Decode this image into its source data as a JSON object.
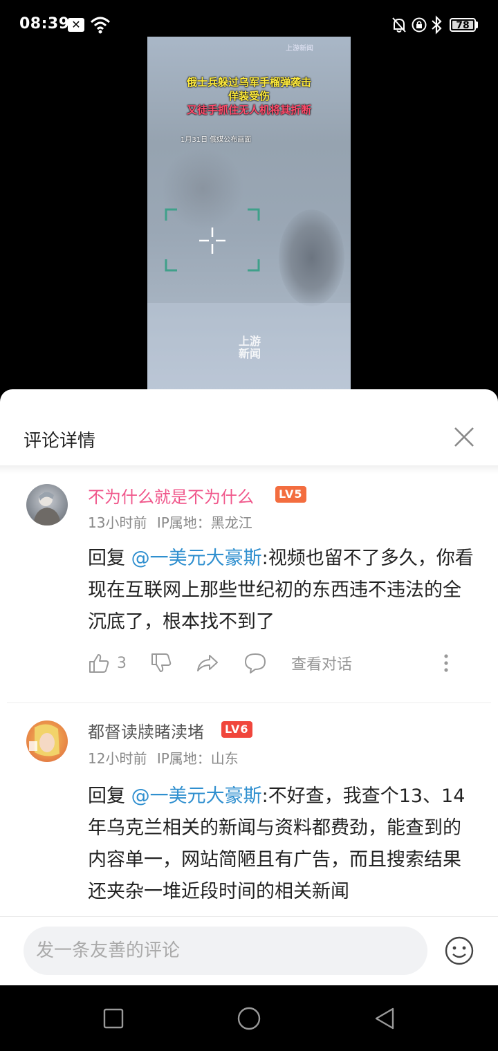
{
  "status_bar": {
    "time": "08:39",
    "notif_glyph": "✕",
    "battery": "78"
  },
  "video": {
    "caption_lines": [
      "俄士兵躲过乌军手榴弹袭击",
      "佯装受伤",
      "又徒手抓住无人机将其折断"
    ],
    "date_text": "1月31日 俄媒公布画面",
    "logo_top": "上游新闻",
    "logo_mid": "上游新闻"
  },
  "sheet": {
    "title": "评论详情"
  },
  "comments": [
    {
      "username": "不为什么就是不为什么",
      "level": "LV5",
      "level_color": "#f36d3f",
      "name_color": "#f0578b",
      "time": "13小时前",
      "ip": "IP属地：黑龙江",
      "reply_prefix": "回复",
      "mention": "@一美元大豪斯",
      "text": ":视频也留不了多久，你看现在互联网上那些世纪初的东西违不违法的全沉底了，根本找不到了",
      "likes": "3",
      "view_conversation": "查看对话"
    },
    {
      "username": "都督读牍睹渎堵",
      "level": "LV6",
      "level_color": "#f0463c",
      "name_color": "#555555",
      "time": "12小时前",
      "ip": "IP属地：山东",
      "reply_prefix": "回复",
      "mention": "@一美元大豪斯",
      "text": ":不好查，我查个13、14年乌克兰相关的新闻与资料都费劲，能查到的内容单一，网站简陋且有广告，而且搜索结果还夹杂一堆近段时间的相关新闻"
    }
  ],
  "input": {
    "placeholder": "发一条友善的评论"
  },
  "icons": [
    "wifi-icon",
    "bell-off-icon",
    "lock-icon",
    "bluetooth-icon",
    "battery-icon",
    "close-icon",
    "like-icon",
    "dislike-icon",
    "share-icon",
    "comment-icon",
    "more-icon",
    "emoji-icon",
    "nav-recents-icon",
    "nav-home-icon",
    "nav-back-icon"
  ]
}
